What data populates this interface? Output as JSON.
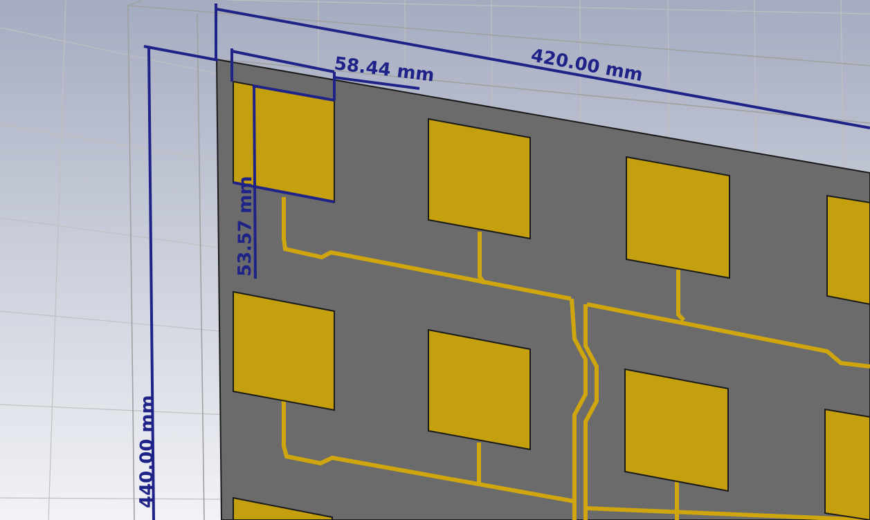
{
  "viewport": {
    "background_top": "#a5acc0",
    "background_bottom": "#f2f3f7",
    "grid_color": "#c0c0c0",
    "box_outline": "#a0a0a0"
  },
  "model": {
    "substrate_color": "#6b6b6b",
    "patch_color": "#c49f0e",
    "patch_outline": "#1a1a1a",
    "feed_line_color": "#d0a60f"
  },
  "dimensions": {
    "color": "#1f2388",
    "board_width": "420.00 mm",
    "board_height": "440.00 mm",
    "patch_width": "58.44 mm",
    "patch_height": "53.57 mm"
  }
}
